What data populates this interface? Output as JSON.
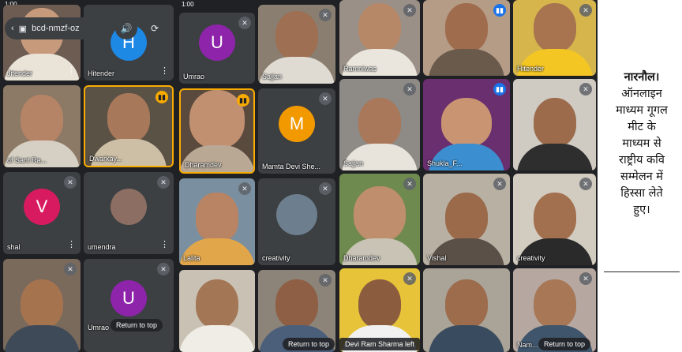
{
  "screen1": {
    "status_time": "1:00",
    "meeting_code": "bcd-nmzf-oz",
    "tiles": [
      {
        "name": "Jitender"
      },
      {
        "name": "Hitender",
        "avatar": "H"
      },
      {
        "name": "of Sant Ra..."
      },
      {
        "name": "Dwarkay..."
      },
      {
        "name": "shal",
        "avatar": "V"
      },
      {
        "name": "umendra"
      },
      {
        "name": ""
      },
      {
        "name": "Umrao",
        "avatar": "U"
      }
    ],
    "return_label": "Return to top"
  },
  "screen2": {
    "status_time": "1:00",
    "tiles": [
      {
        "name": "Umrao",
        "avatar": "U"
      },
      {
        "name": "Sajjan"
      },
      {
        "name": "Dharamdev"
      },
      {
        "name": "Mamta Devi She...",
        "avatar": "M"
      },
      {
        "name": "Lalita"
      },
      {
        "name": "creativity"
      },
      {
        "name": ""
      },
      {
        "name": ""
      }
    ],
    "return_label": "Return to top"
  },
  "screen3": {
    "tiles": [
      {
        "name": "Ramniwas"
      },
      {
        "name": ""
      },
      {
        "name": "Hitender"
      },
      {
        "name": "Sajjan"
      },
      {
        "name": "Shukla_F..."
      },
      {
        "name": ""
      },
      {
        "name": "Dharamdev"
      },
      {
        "name": "Vishal"
      },
      {
        "name": "creativity"
      },
      {
        "name": ""
      },
      {
        "name": ""
      },
      {
        "name": "Nam..."
      }
    ],
    "left_label": "Devi Ram Sharma left",
    "return_label": "Return to top"
  },
  "caption": {
    "lines": [
      "नारनौल।",
      "ऑनलाइन",
      "माध्यम गूगल",
      "मीट के",
      "माध्यम से",
      "राष्ट्रीय कवि",
      "सम्मेलन में",
      "हिस्सा लेते",
      "हुए।"
    ]
  },
  "colors": {
    "meet_dark": "#202124",
    "tile_gray": "#3c4043",
    "speaking": "#f9ab00",
    "avatar_purple": "#8e24aa",
    "avatar_orange": "#f29900",
    "avatar_pink": "#d81b60",
    "avatar_blue": "#1e88e5"
  }
}
